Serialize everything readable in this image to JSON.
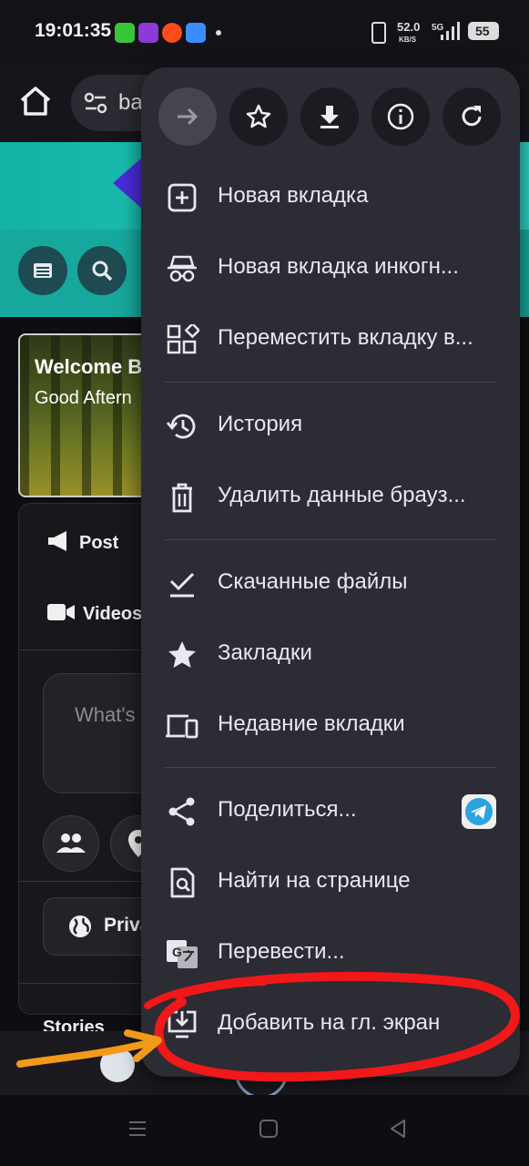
{
  "status_bar": {
    "time": "19:01:35",
    "net_speed_value": "52.0",
    "net_speed_unit": "KB/S",
    "network_type": "5G",
    "battery": "55"
  },
  "toolbar": {
    "url_text": "ba"
  },
  "page": {
    "welcome_title": "Welcome B",
    "welcome_subtitle": "Good Aftern",
    "post_label": "Post",
    "videos_label": "Videos",
    "whats_placeholder": "What's",
    "privacy_label": "Priva",
    "stories_label": "Stories"
  },
  "menu": {
    "top_actions": [
      {
        "name": "forward",
        "icon": "arrow-right-icon",
        "enabled": false
      },
      {
        "name": "bookmark",
        "icon": "star-outline-icon",
        "enabled": true
      },
      {
        "name": "download",
        "icon": "download-icon",
        "enabled": true
      },
      {
        "name": "page-info",
        "icon": "info-icon",
        "enabled": true
      },
      {
        "name": "reload",
        "icon": "reload-icon",
        "enabled": true
      }
    ],
    "items": [
      {
        "label": "Новая вкладка",
        "icon": "new-tab-icon"
      },
      {
        "label": "Новая вкладка инкогн...",
        "icon": "incognito-icon"
      },
      {
        "label": "Переместить вкладку в...",
        "icon": "move-tab-icon"
      },
      {
        "label": "История",
        "icon": "history-icon"
      },
      {
        "label": "Удалить данные брауз...",
        "icon": "trash-icon"
      },
      {
        "label": "Скачанные файлы",
        "icon": "downloads-check-icon"
      },
      {
        "label": "Закладки",
        "icon": "bookmarks-star-icon"
      },
      {
        "label": "Недавние вкладки",
        "icon": "devices-icon"
      },
      {
        "label": "Поделиться...",
        "icon": "share-icon"
      },
      {
        "label": "Найти на странице",
        "icon": "find-in-page-icon"
      },
      {
        "label": "Перевести...",
        "icon": "translate-icon"
      },
      {
        "label": "Добавить на гл. экран",
        "icon": "add-to-home-icon"
      }
    ]
  },
  "colors": {
    "menu_bg": "#2c2c34",
    "annotation_red": "#f01818",
    "annotation_orange": "#f29a1a",
    "banner_teal": "#17a89d"
  }
}
